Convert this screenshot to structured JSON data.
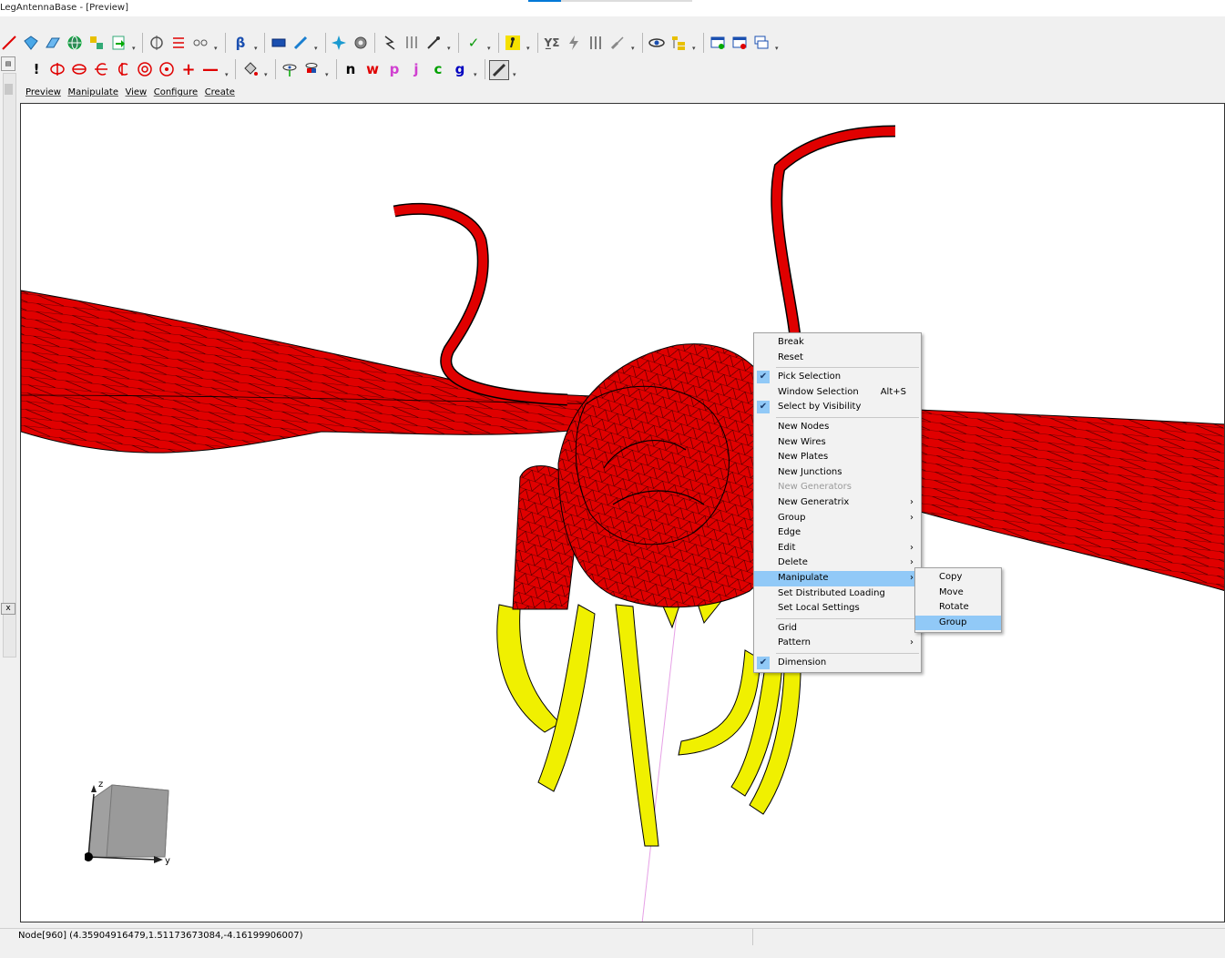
{
  "window": {
    "title": "LegAntennaBase - [Preview]"
  },
  "toolbar1": {
    "icons": [
      "line-tool-icon",
      "diamond-plate-icon",
      "plane-icon",
      "globe-icon",
      "node-shapes-icon",
      "import-icon",
      "symmetry-icon",
      "align-icon",
      "connect-icon",
      "beta-icon",
      "rectangle-plate-icon",
      "pen-tool-icon",
      "star-node-icon",
      "gear-icon",
      "lightning-icon",
      "loads-icon",
      "probe-icon",
      "check-icon",
      "solver-run-icon",
      "stress-icon",
      "flash-icon",
      "displacement-icon",
      "wave-icon",
      "eye-icon",
      "tree-icon",
      "add-window-icon",
      "close-window-icon",
      "cascade-window-icon"
    ]
  },
  "toolbar2": {
    "icons": [
      "exclaim-icon",
      "rotate-axis-1-icon",
      "rotate-axis-2-icon",
      "rotate-axis-3-icon",
      "rotate-axis-4-icon",
      "target-icon",
      "spin-target-icon",
      "plus-icon",
      "minus-icon",
      "paint-bucket-icon",
      "node-view-icon",
      "color-view-icon"
    ],
    "letters": [
      {
        "label": "n",
        "color": "#000000"
      },
      {
        "label": "w",
        "color": "#e00000"
      },
      {
        "label": "p",
        "color": "#d040d0"
      },
      {
        "label": "j",
        "color": "#d040d0"
      },
      {
        "label": "c",
        "color": "#00a000"
      },
      {
        "label": "g",
        "color": "#0000c0"
      }
    ],
    "ruler_icon": "ruler-icon"
  },
  "menubar": [
    "Preview",
    "Manipulate",
    "View",
    "Configure",
    "Create"
  ],
  "context_menu": {
    "items": [
      {
        "label": "Break"
      },
      {
        "label": "Reset"
      },
      {
        "sep": true
      },
      {
        "label": "Pick Selection",
        "checked": true
      },
      {
        "label": "Window Selection",
        "shortcut": "Alt+S"
      },
      {
        "label": "Select by Visibility",
        "checked": true
      },
      {
        "sep": true
      },
      {
        "label": "New Nodes"
      },
      {
        "label": "New Wires"
      },
      {
        "label": "New Plates"
      },
      {
        "label": "New Junctions"
      },
      {
        "label": "New Generators",
        "disabled": true
      },
      {
        "label": "New Generatrix",
        "submenu": true
      },
      {
        "label": "Group",
        "submenu": true
      },
      {
        "label": "Edge"
      },
      {
        "label": "Edit",
        "submenu": true
      },
      {
        "label": "Delete",
        "submenu": true
      },
      {
        "label": "Manipulate",
        "submenu": true,
        "highlighted": true
      },
      {
        "label": "Set Distributed Loading"
      },
      {
        "label": "Set Local Settings"
      },
      {
        "sep": true
      },
      {
        "label": "Grid"
      },
      {
        "label": "Pattern",
        "submenu": true
      },
      {
        "sep": true
      },
      {
        "label": "Dimension",
        "checked": true
      }
    ]
  },
  "submenu": {
    "items": [
      {
        "label": "Copy"
      },
      {
        "label": "Move"
      },
      {
        "label": "Rotate"
      },
      {
        "label": "Group",
        "highlighted": true
      }
    ]
  },
  "axes": {
    "z": "z",
    "y": "y"
  },
  "status": {
    "text": "Node[960] (4.35904916479,1.51173673084,-4.16199906007)"
  },
  "colors": {
    "body": "#e00000",
    "legs": "#f0f000",
    "mesh": "#000000",
    "highlight": "#91c9f7"
  },
  "left_panel": {
    "close_label": "x"
  }
}
